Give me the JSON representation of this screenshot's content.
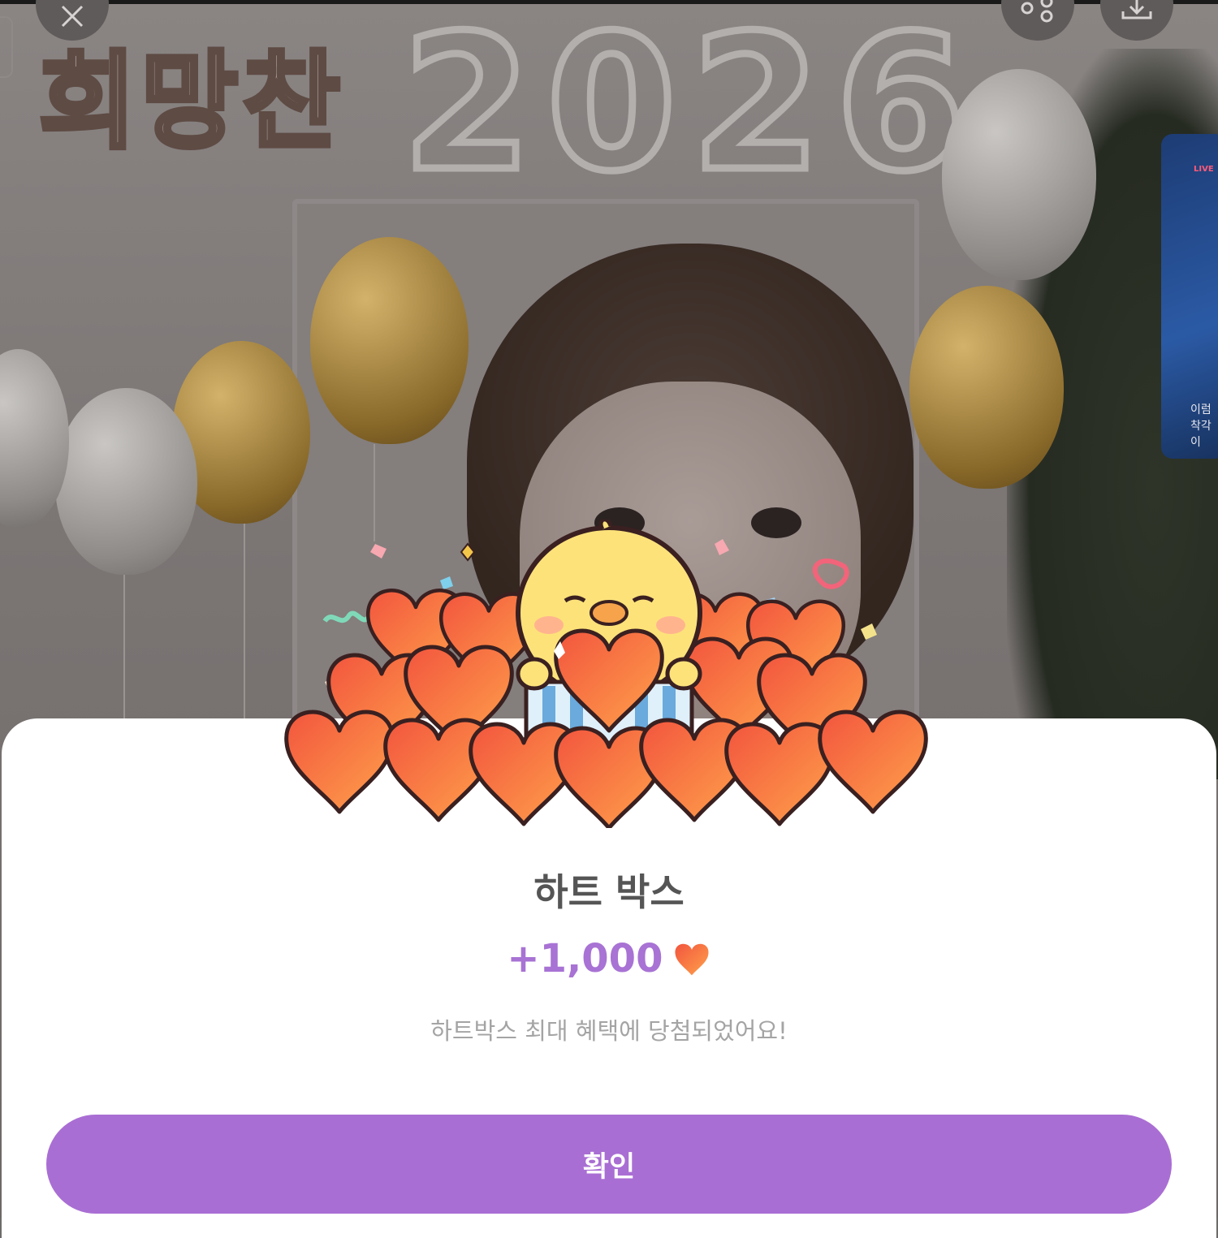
{
  "background": {
    "banner_text": "희망찬",
    "year_text": "2026",
    "side_card_badge": "LIVE",
    "side_card_text_line1": "이럼",
    "side_card_text_line2": "착각이"
  },
  "top_controls": {
    "close_icon": "close-icon",
    "share_icon": "share-icon",
    "download_icon": "download-icon"
  },
  "reward_sheet": {
    "title": "하트 박스",
    "amount": "+1,000",
    "amount_icon": "heart-icon",
    "description": "하트박스 최대 혜택에 당첨되었어요!",
    "confirm_label": "확인"
  },
  "colors": {
    "accent": "#a96ed3",
    "amount_text": "#a873d4",
    "heart": "#f4593f"
  }
}
